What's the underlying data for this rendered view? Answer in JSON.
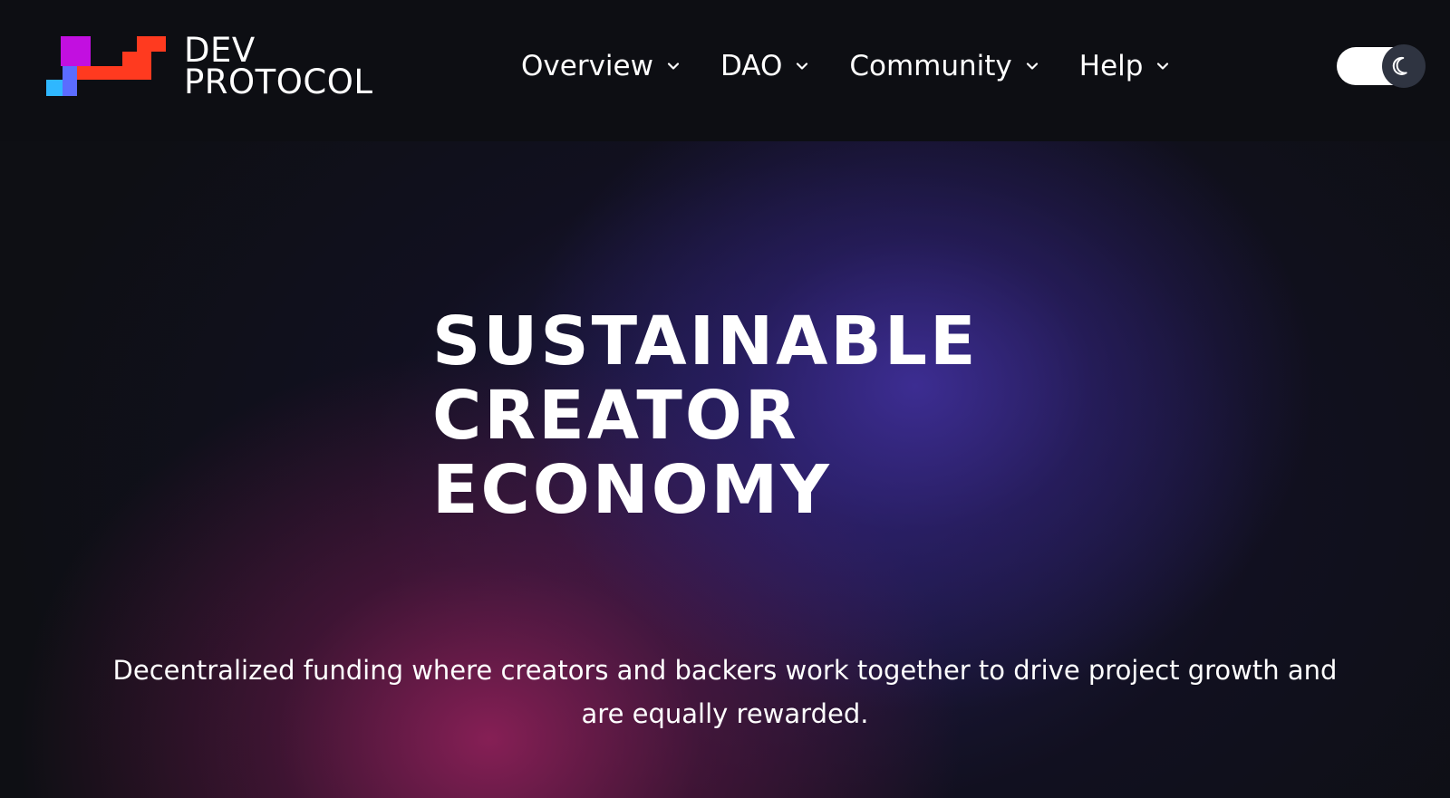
{
  "header": {
    "logo": {
      "line1": "DEV",
      "line2": "PROTOCOL",
      "colors": [
        "#c20fe0",
        "#ff3a1f",
        "#2fb7ff",
        "#5b6cff"
      ]
    },
    "nav": [
      {
        "label": "Overview",
        "icon": "chevron-down-icon"
      },
      {
        "label": "DAO",
        "icon": "chevron-down-icon"
      },
      {
        "label": "Community",
        "icon": "chevron-down-icon"
      },
      {
        "label": "Help",
        "icon": "chevron-down-icon"
      }
    ],
    "theme_toggle": {
      "icon": "moon-icon",
      "state": "dark"
    }
  },
  "hero": {
    "title_lines": [
      "SUSTAINABLE",
      "CREATOR",
      "ECONOMY"
    ],
    "subtitle": "Decentralized funding where creators and backers work together to drive project growth and are equally rewarded."
  },
  "colors": {
    "background": "#0e0f14",
    "glow_blue": "#3e2e96",
    "glow_magenta": "#8c2058",
    "text": "#ffffff"
  }
}
